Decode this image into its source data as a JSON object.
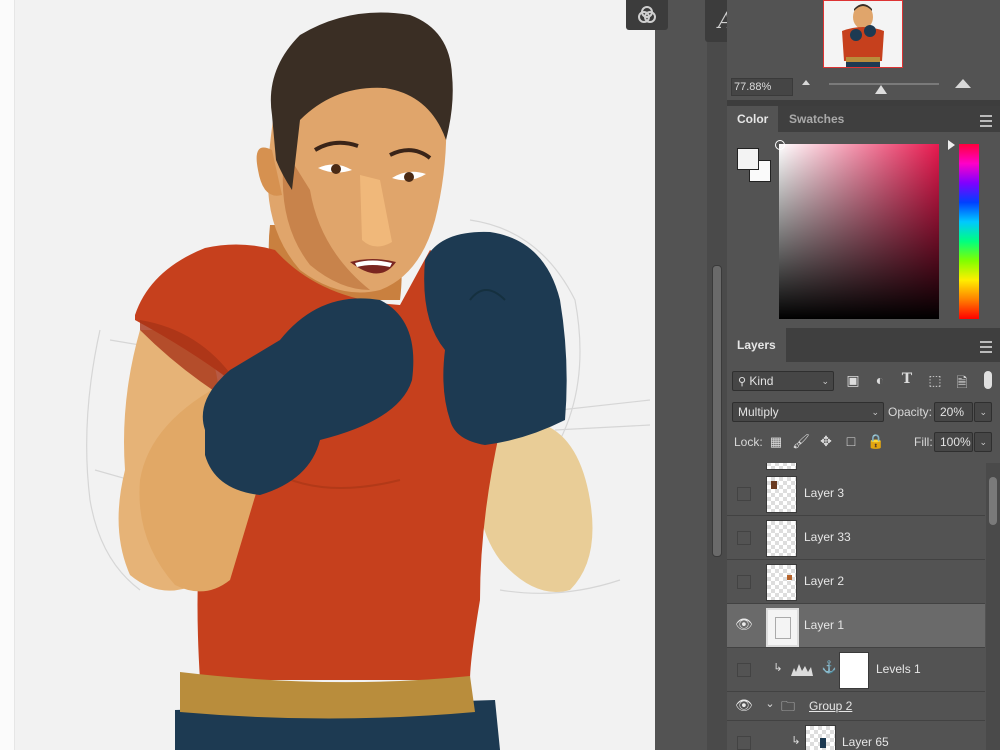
{
  "navigator": {
    "zoom": "77.88%"
  },
  "color_panel": {
    "tabs": [
      "Color",
      "Swatches"
    ],
    "foreground_color": "#f3f3f3",
    "background_color": "#fafafa",
    "hue": "#e8194f"
  },
  "layers_panel": {
    "title": "Layers",
    "filter_label": "Kind",
    "blend_mode": "Multiply",
    "opacity_label": "Opacity:",
    "opacity_value": "20%",
    "lock_label": "Lock:",
    "fill_label": "Fill:",
    "fill_value": "100%",
    "layers": [
      {
        "name": "Layer 3",
        "visible": false
      },
      {
        "name": "Layer 33",
        "visible": false
      },
      {
        "name": "Layer 2",
        "visible": false
      },
      {
        "name": "Layer 1",
        "visible": true,
        "selected": true
      },
      {
        "name": "Levels 1",
        "visible": false,
        "type": "adjustment",
        "clipped": true
      },
      {
        "name": "Group 2",
        "visible": true,
        "type": "group",
        "expanded": true
      },
      {
        "name": "Layer 65",
        "visible": false,
        "clipped": true
      }
    ]
  },
  "icons": [
    "channels-icon",
    "glyphs-icon",
    "small-mountain-icon",
    "large-mountain-icon",
    "panel-menu-icon",
    "search-icon",
    "image-filter-icon",
    "adjustment-filter-icon",
    "type-filter-icon",
    "shape-filter-icon",
    "smart-object-filter-icon",
    "filter-toggle-icon",
    "lock-transparent-icon",
    "lock-paint-icon",
    "lock-position-icon",
    "lock-artboard-icon",
    "lock-all-icon",
    "eye-icon",
    "clip-arrow-icon",
    "levels-icon",
    "link-icon",
    "folder-icon",
    "disclosure-icon"
  ],
  "canvas_colors": {
    "shirt": "#c6401d",
    "gloves": "#1d3a52",
    "skin": "#e0a56b",
    "hair": "#3a2e24",
    "belt": "#b98d3c",
    "shorts": "#1d3a52"
  }
}
